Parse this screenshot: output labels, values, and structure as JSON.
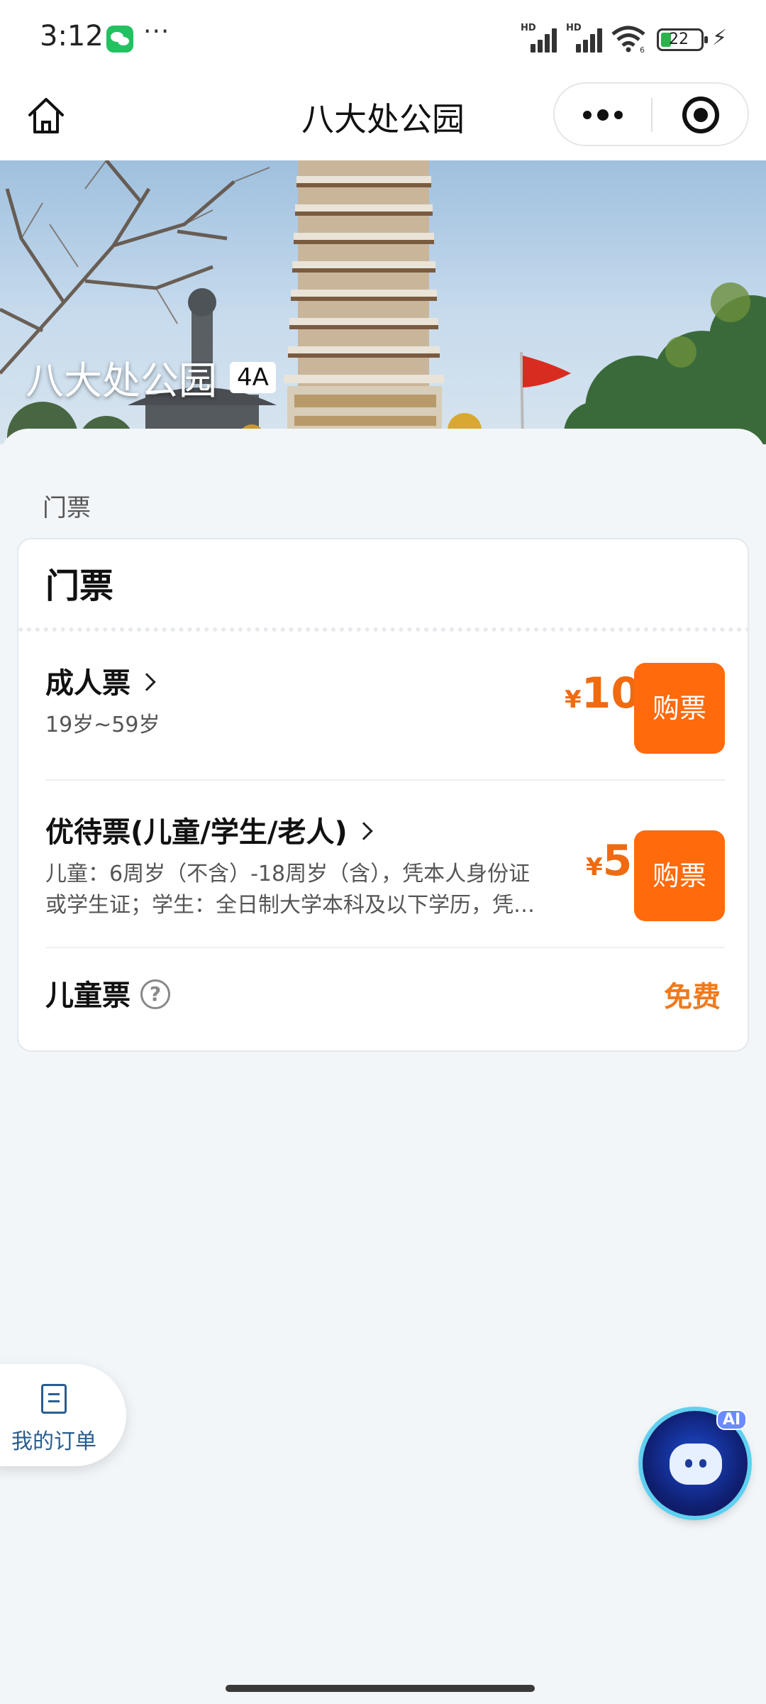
{
  "status_bar": {
    "time": "3:12",
    "more": "···",
    "signal_1_label": "HD",
    "signal_2_label": "HD",
    "wifi_label": "6",
    "battery": "22"
  },
  "nav": {
    "title": "八大处公园"
  },
  "hero": {
    "park_name": "八大处公园",
    "rating_badge": "4A"
  },
  "section_label": "门票",
  "card": {
    "title": "门票",
    "tickets": [
      {
        "name": "成人票",
        "subtitle": "19岁~59岁",
        "currency": "¥",
        "price": "10",
        "buy_label": "购票"
      },
      {
        "name": "优待票(儿童/学生/老人)",
        "subtitle_line1": "儿童：6周岁（不含）-18周岁（含），凭本人身份证",
        "subtitle_line2": "或学生证；学生：全日制大学本科及以下学历，凭…",
        "currency": "¥",
        "price": "5",
        "buy_label": "购票"
      },
      {
        "name": "儿童票",
        "help": "?",
        "price_text": "免费"
      }
    ]
  },
  "floating": {
    "my_orders": "我的订单",
    "ai_tag": "AI"
  },
  "colors": {
    "accent": "#ff6a0c",
    "price": "#f06a10",
    "order_link": "#2a5d8f"
  }
}
